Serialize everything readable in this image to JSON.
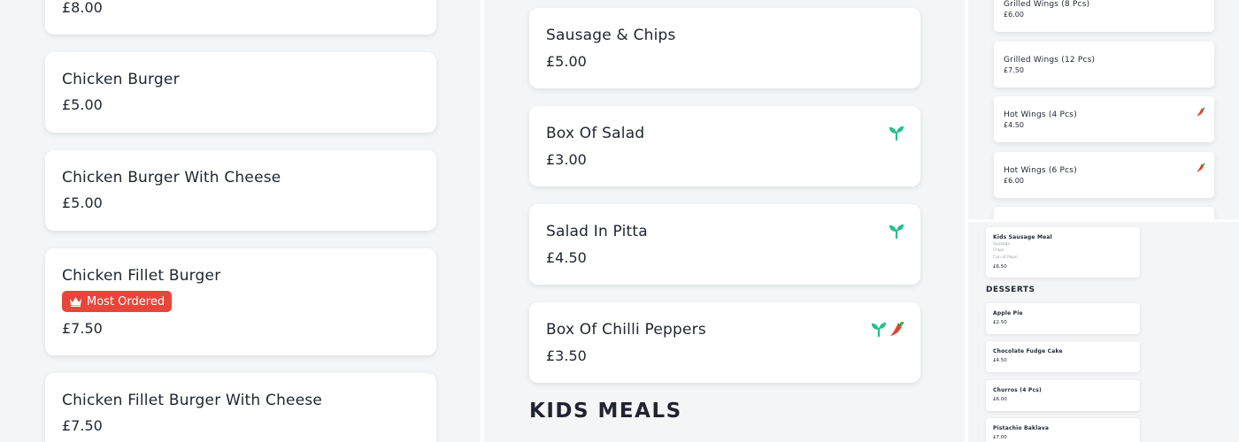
{
  "left_column": {
    "top_price": "£8.00",
    "items": [
      {
        "name": "Chicken Burger",
        "price": "£5.00"
      },
      {
        "name": "Chicken Burger With Cheese",
        "price": "£5.00"
      },
      {
        "name": "Chicken Fillet Burger",
        "badge": "Most Ordered",
        "price": "£7.50"
      },
      {
        "name": "Chicken Fillet Burger With Cheese",
        "price": "£7.50"
      }
    ]
  },
  "middle_column": {
    "items": [
      {
        "name": "Sausage & Chips",
        "price": "£5.00"
      },
      {
        "name": "Box Of Salad",
        "price": "£3.00",
        "icons": [
          "vegan-sprout-icon"
        ]
      },
      {
        "name": "Salad In Pitta",
        "price": "£4.50",
        "icons": [
          "vegan-sprout-icon"
        ]
      },
      {
        "name": "Box Of Chilli Peppers",
        "price": "£3.50",
        "icons": [
          "vegan-sprout-icon",
          "chilli-pepper-icon"
        ]
      }
    ],
    "section_title": "KIDS MEALS"
  },
  "right_top": {
    "items": [
      {
        "name": "Grilled Wings (8 Pcs)",
        "price": "£6.00"
      },
      {
        "name": "Grilled Wings (12 Pcs)",
        "price": "£7.50"
      },
      {
        "name": "Hot Wings (4 Pcs)",
        "price": "£4.50",
        "icons": [
          "chilli-pepper-icon"
        ]
      },
      {
        "name": "Hot Wings (6 Pcs)",
        "price": "£6.00",
        "icons": [
          "chilli-pepper-icon"
        ]
      }
    ]
  },
  "right_bottom": {
    "kids_meal": {
      "name": "Kids Sausage Meal",
      "desc": [
        "Sausage",
        "Chips",
        "Can of Pepsi"
      ],
      "price": "£6.50"
    },
    "section_title": "DESSERTS",
    "items": [
      {
        "name": "Apple Pie",
        "price": "£2.50"
      },
      {
        "name": "Chocolate Fudge Cake",
        "price": "£4.50"
      },
      {
        "name": "Churros (4 Pcs)",
        "price": "£6.00"
      },
      {
        "name": "Pistachio Baklava",
        "price": "£7.00"
      }
    ]
  },
  "colors": {
    "badge": "#e8463b",
    "vegan": "#22c08a",
    "chilli": "#e0452e"
  }
}
